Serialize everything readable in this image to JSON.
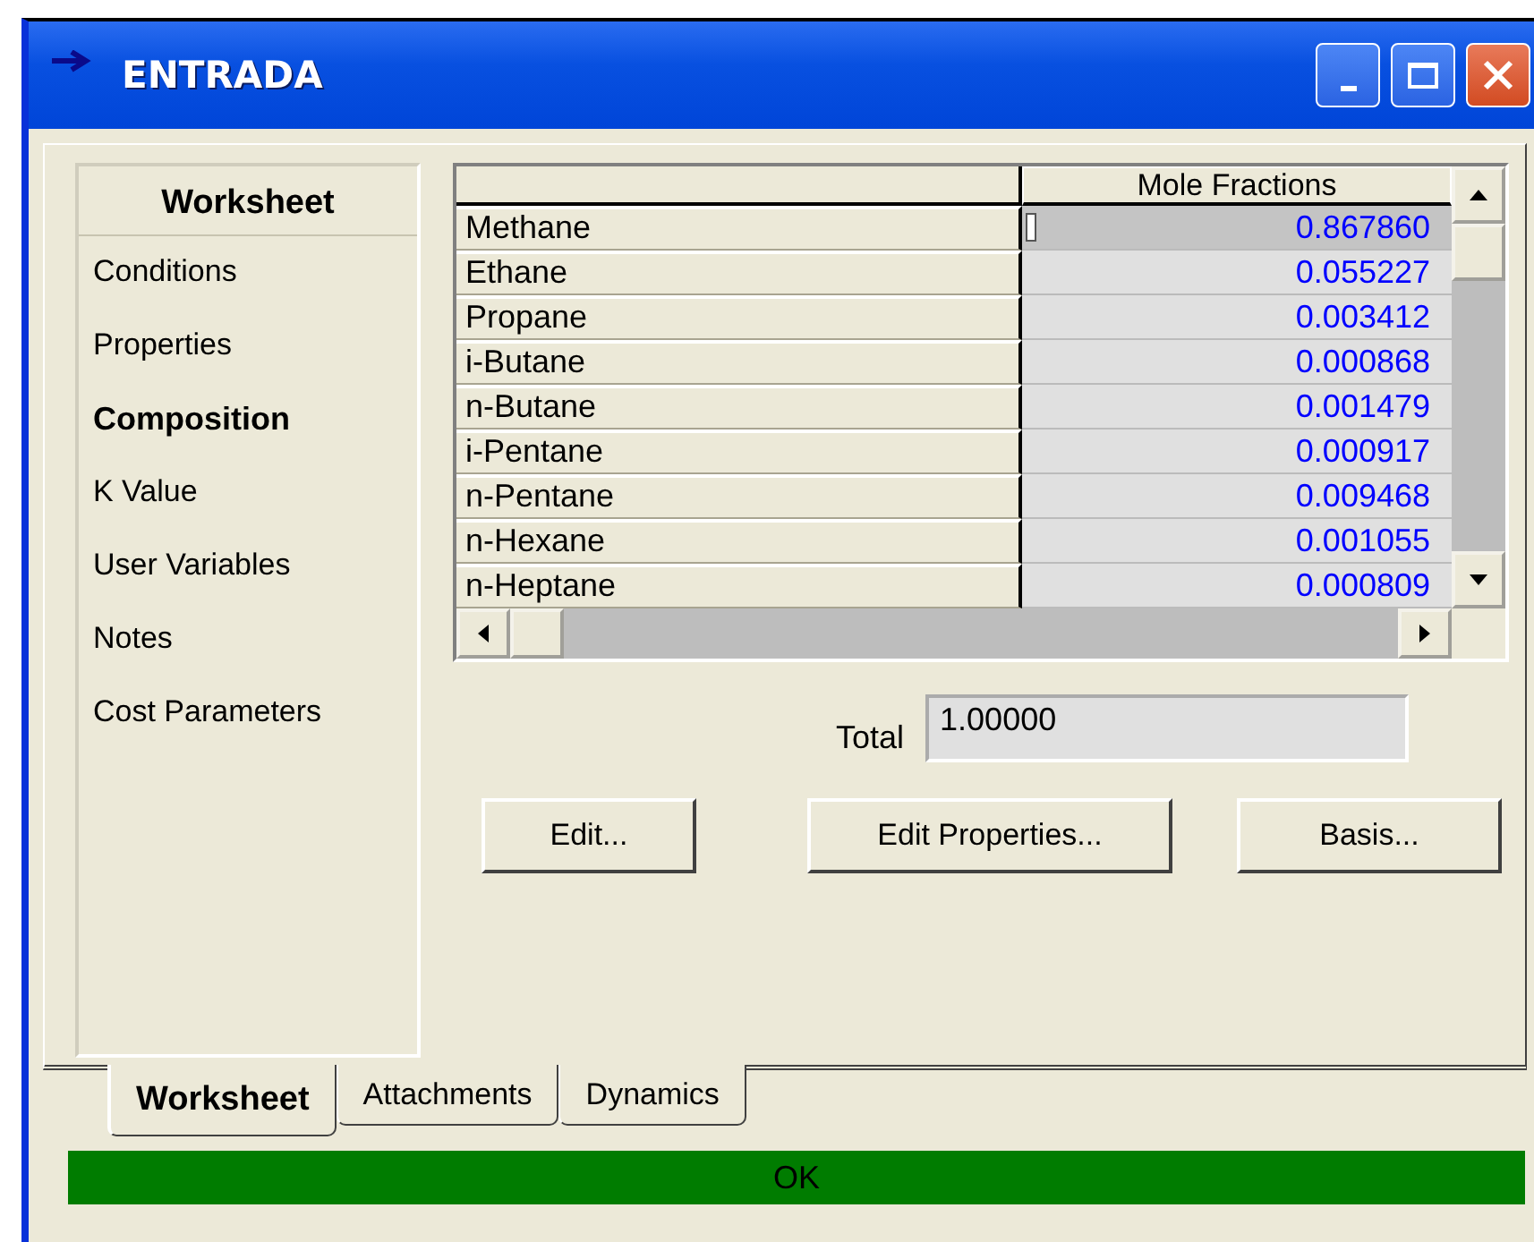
{
  "window": {
    "title": "ENTRADA"
  },
  "sidebar": {
    "heading": "Worksheet",
    "items": [
      {
        "label": "Conditions",
        "selected": false
      },
      {
        "label": "Properties",
        "selected": false
      },
      {
        "label": "Composition",
        "selected": true
      },
      {
        "label": "K Value",
        "selected": false
      },
      {
        "label": "User Variables",
        "selected": false
      },
      {
        "label": "Notes",
        "selected": false
      },
      {
        "label": "Cost Parameters",
        "selected": false
      }
    ]
  },
  "table": {
    "columns": [
      "Mole Fractions"
    ],
    "rows": [
      {
        "component": "Methane",
        "value": "0.867860",
        "selected": true
      },
      {
        "component": "Ethane",
        "value": "0.055227",
        "selected": false
      },
      {
        "component": "Propane",
        "value": "0.003412",
        "selected": false
      },
      {
        "component": "i-Butane",
        "value": "0.000868",
        "selected": false
      },
      {
        "component": "n-Butane",
        "value": "0.001479",
        "selected": false
      },
      {
        "component": "i-Pentane",
        "value": "0.000917",
        "selected": false
      },
      {
        "component": "n-Pentane",
        "value": "0.009468",
        "selected": false
      },
      {
        "component": "n-Hexane",
        "value": "0.001055",
        "selected": false
      },
      {
        "component": "n-Heptane",
        "value": "0.000809",
        "selected": false
      }
    ]
  },
  "total": {
    "label": "Total",
    "value": "1.00000"
  },
  "buttons": [
    "Edit...",
    "Edit Properties...",
    "Basis..."
  ],
  "tabs": [
    {
      "label": "Worksheet",
      "selected": true
    },
    {
      "label": "Attachments",
      "selected": false
    },
    {
      "label": "Dynamics",
      "selected": false
    }
  ],
  "status_bar": {
    "text": "OK",
    "color": "#007c00"
  }
}
